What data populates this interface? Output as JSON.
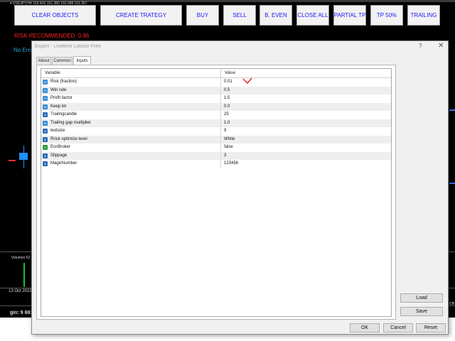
{
  "chart": {
    "ticker": "▾ USDJPY,H4  150.426 151.380 150.388 151.357",
    "buttons": [
      "CLEAR OBJECTS",
      "CREATE TRATEGY",
      "BUY",
      "SELL",
      "B. EVEN",
      "CLOSE ALL",
      "PARTIAL TP",
      "TP 50%",
      "TRAILING"
    ],
    "risk_recommended": "RISK RECOMMENDED: 0.96",
    "no_error": "No Erro",
    "volumes_label": "Volumes 52",
    "date_label": "13 Oct 2022",
    "margin_label": "gin: 9 691",
    "right_cut_label": "ce"
  },
  "dialog": {
    "title": "Expert - Livetime Lotsize Free",
    "help_glyph": "?",
    "close_glyph": "✕",
    "tabs": [
      "About",
      "Common",
      "Inputs"
    ],
    "active_tab": "Inputs",
    "headers": {
      "variable": "Variable",
      "value": "Value"
    },
    "rows": [
      {
        "icon": "V2",
        "label": "Risk (fraction)",
        "value": "0.01"
      },
      {
        "icon": "V2",
        "label": "Win rate",
        "value": "0.5"
      },
      {
        "icon": "V2",
        "label": "Profit factor",
        "value": "1.5"
      },
      {
        "icon": "V2",
        "label": "Keep lot",
        "value": "0.0"
      },
      {
        "icon": "123",
        "label": "Trailingcandle",
        "value": "25"
      },
      {
        "icon": "V2",
        "label": "Trailing gap multiplier",
        "value": "1.0"
      },
      {
        "icon": "123",
        "label": "textsize",
        "value": "9"
      },
      {
        "icon": "123",
        "label": "Rrisk optimize level",
        "value": "White"
      },
      {
        "icon": "bool",
        "label": "EcnBroker",
        "value": "false"
      },
      {
        "icon": "123",
        "label": "Slippage",
        "value": "3"
      },
      {
        "icon": "123",
        "label": "MagicNumber",
        "value": "123456"
      }
    ],
    "load_label": "Load",
    "save_label": "Save",
    "ok_label": "OK",
    "cancel_label": "Cancel",
    "reset_label": "Reset"
  },
  "colors": {
    "button_text": "#1a1aff",
    "risk_text": "#ff2020",
    "no_error_text": "#2aa3d6",
    "checkmark": "#e02020"
  }
}
